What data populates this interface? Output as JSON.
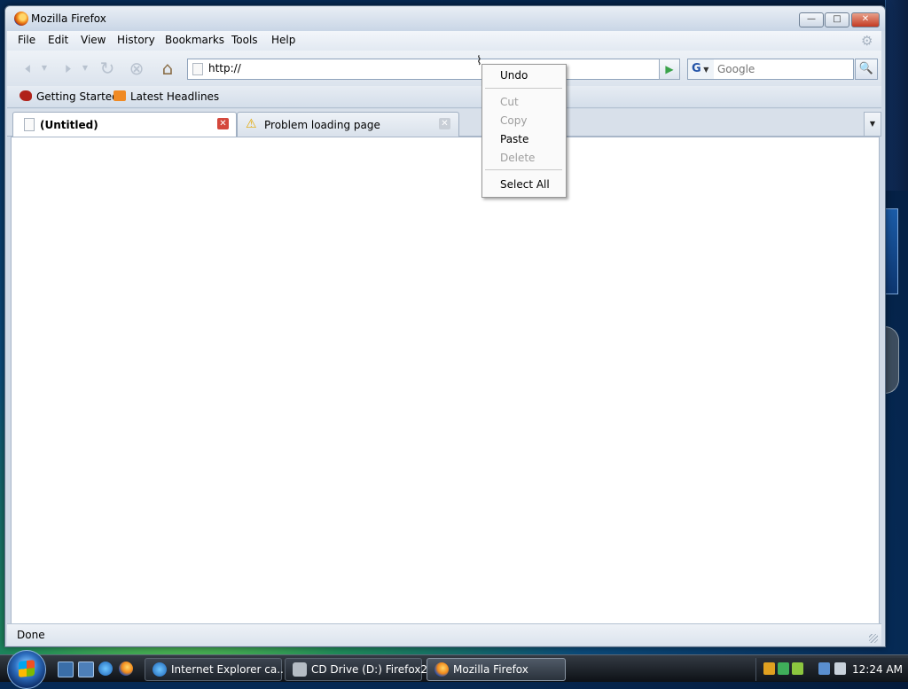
{
  "window": {
    "title": "Mozilla Firefox"
  },
  "menubar": {
    "items": [
      "File",
      "Edit",
      "View",
      "History",
      "Bookmarks",
      "Tools",
      "Help"
    ]
  },
  "navbar": {
    "url": "http://",
    "search_placeholder": "Google",
    "search_engine_letter": "G"
  },
  "bookmarks": {
    "items": [
      "Getting Started",
      "Latest Headlines"
    ]
  },
  "tabs": [
    {
      "label": "(Untitled)"
    },
    {
      "label": "Problem loading page"
    }
  ],
  "context_menu": {
    "undo": "Undo",
    "cut": "Cut",
    "copy": "Copy",
    "paste": "Paste",
    "delete": "Delete",
    "select_all": "Select All"
  },
  "status": {
    "text": "Done"
  },
  "taskbar": {
    "buttons": [
      "Internet Explorer ca...",
      "CD Drive (D:) Firefox2",
      "Mozilla Firefox"
    ],
    "clock": "12:24 AM"
  }
}
